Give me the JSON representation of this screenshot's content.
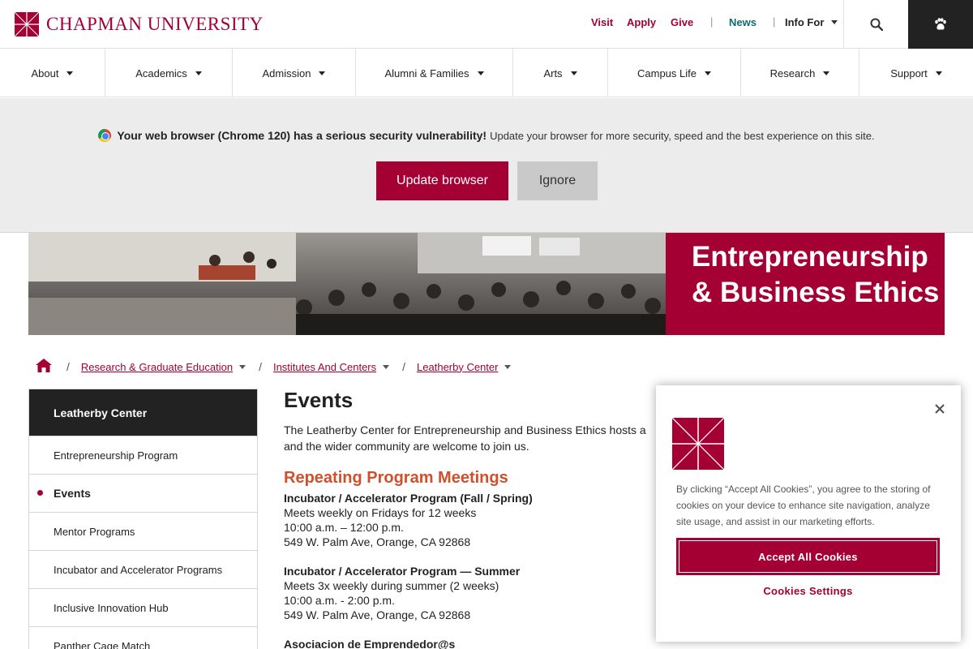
{
  "header": {
    "logo_text": "CHAPMAN UNIVERSITY",
    "util_links": {
      "visit": "Visit",
      "apply": "Apply",
      "give": "Give",
      "news": "News",
      "info_for": "Info For"
    },
    "separator": "|",
    "icons": {
      "search": "search-icon",
      "paw": "paw-icon"
    }
  },
  "nav": {
    "items": [
      "About",
      "Academics",
      "Admission",
      "Alumni & Families",
      "Arts",
      "Campus Life",
      "Research",
      "Support"
    ]
  },
  "browser_warning": {
    "headline": "Your web browser (Chrome 120) has a serious security vulnerability!",
    "message": "Update your browser for more security, speed and the best experience on this site.",
    "update_label": "Update browser",
    "ignore_label": "Ignore"
  },
  "hero": {
    "title_line1": "Entrepreneurship",
    "title_line2": "& Business Ethics"
  },
  "breadcrumb": {
    "items": [
      "Research & Graduate Education",
      "Institutes And Centers",
      "Leatherby Center"
    ],
    "separator": "/"
  },
  "sidebar": {
    "title": "Leatherby Center",
    "items": [
      "Entrepreneurship Program",
      "Events",
      "Mentor Programs",
      "Incubator and Accelerator Programs",
      "Inclusive Innovation Hub",
      "Panther Cage Match"
    ],
    "active": "Events"
  },
  "main": {
    "title": "Events",
    "intro_line1": "The Leatherby Center for Entrepreneurship and Business Ethics hosts a",
    "intro_line2": "and the wider community are welcome to join us.",
    "section_title": "Repeating Program Meetings",
    "events": [
      {
        "title": "Incubator / Accelerator Program (Fall / Spring)",
        "line1": "Meets weekly on Fridays for 12 weeks",
        "line2": "10:00 a.m. – 12:00 p.m.",
        "line3": "549 W. Palm Ave, Orange, CA 92868"
      },
      {
        "title": "Incubator / Accelerator Program — Summer",
        "line1": "Meets 3x weekly during summer (2 weeks)",
        "line2": "10:00 a.m. - 2:00 p.m.",
        "line3": "549 W. Palm Ave, Orange, CA 92868"
      },
      {
        "title": "Asociacion de Emprendedor@s"
      }
    ]
  },
  "cookie": {
    "text": "By clicking “Accept All Cookies”, you agree to the storing of cookies on your device to enhance site navigation, analyze site usage, and assist in our marketing efforts.",
    "accept_label": "Accept All Cookies",
    "settings_label": "Cookies Settings"
  },
  "colors": {
    "brand": "#a50034",
    "news": "#0f6a76",
    "section_heading": "#d14f2b",
    "dark": "#222222"
  }
}
